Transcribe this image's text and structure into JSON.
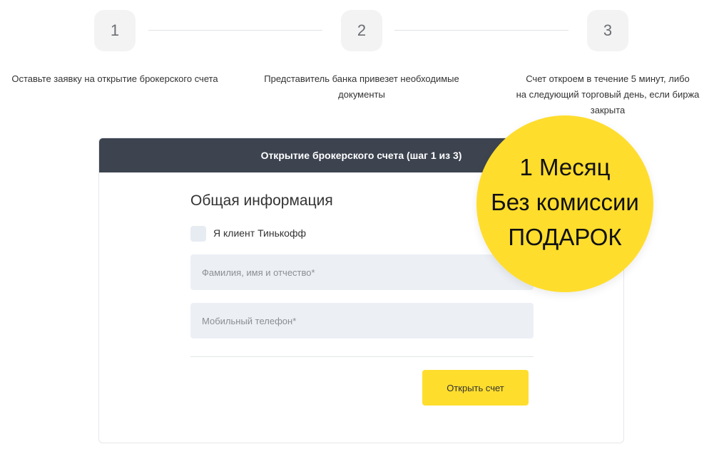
{
  "steps": [
    {
      "number": "1",
      "text": "Оставьте заявку на открытие брокерского счета"
    },
    {
      "number": "2",
      "text_line1": "Представитель банка привезет необходимые",
      "text_line2": "документы"
    },
    {
      "number": "3",
      "text_line1": "Счет откроем в течение 5 минут, либо",
      "text_line2": "на следующий торговый день, если биржа",
      "text_line3": "закрыта"
    }
  ],
  "form": {
    "header_title": "Открытие брокерского счета (шаг 1 из 3)",
    "section_title": "Общая информация",
    "checkbox_label": "Я клиент Тинькофф",
    "fields": {
      "full_name_placeholder": "Фамилия, имя и отчество*",
      "phone_placeholder": "Мобильный телефон*"
    },
    "submit_label": "Открыть счет"
  },
  "promo": {
    "line1": "1 Месяц",
    "line2": "Без комиссии",
    "line3": "ПОДАРОК"
  },
  "colors": {
    "accent_yellow": "#ffdd2d",
    "header_dark": "#3d4450",
    "field_bg": "#ecf0f5"
  }
}
